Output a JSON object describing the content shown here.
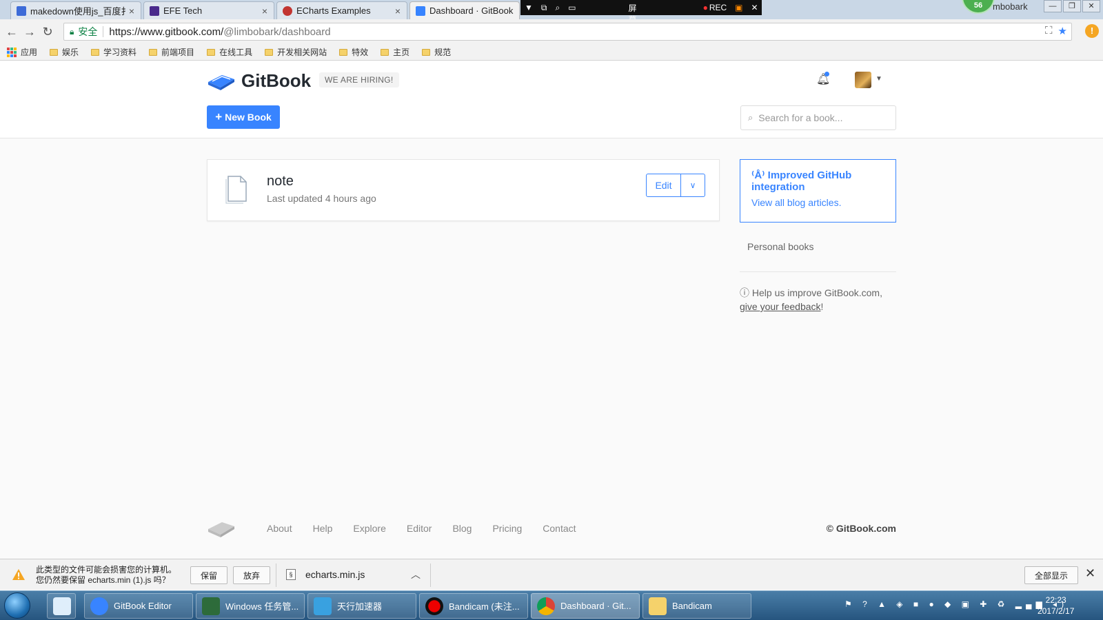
{
  "browser": {
    "tabs": [
      {
        "label": "makedown使用js_百度扌",
        "favicon_color": "#3d6bd8"
      },
      {
        "label": "EFE Tech",
        "favicon_color": "#4a2a8c"
      },
      {
        "label": "ECharts Examples",
        "favicon_color": "#c23531"
      },
      {
        "label": "Dashboard · GitBook",
        "favicon_color": "#3884ff"
      }
    ],
    "rec_bar": {
      "fullscreen": "全屏幕",
      "rec": "REC"
    },
    "profile_badge": "56",
    "profile_name": "mbobark",
    "secure_label": "安全",
    "url_host": "https://www.gitbook.com/",
    "url_path": "@limbobark/dashboard",
    "bookmarks": [
      "应用",
      "娱乐",
      "学习资料",
      "前端项目",
      "在线工具",
      "开发相关网站",
      "特效",
      "主页",
      "规范"
    ]
  },
  "header": {
    "logo_text": "GitBook",
    "hiring": "WE ARE HIRING!",
    "new_book": "New Book",
    "search_placeholder": "Search for a book..."
  },
  "book": {
    "title": "note",
    "meta": "Last updated 4 hours ago",
    "edit_label": "Edit"
  },
  "sidebar": {
    "blog_title": "Improved GitHub integration",
    "blog_link": "View all blog articles.",
    "personal_books": "Personal books",
    "help_text": "Help us improve GitBook.com,",
    "feedback_link": "give your feedback",
    "feedback_suffix": "!"
  },
  "footer": {
    "links": [
      "About",
      "Help",
      "Explore",
      "Editor",
      "Blog",
      "Pricing",
      "Contact"
    ],
    "copyright": "© GitBook.com"
  },
  "download_bar": {
    "warning_line1": "此类型的文件可能会损害您的计算机。",
    "warning_line2": "您仍然要保留 echarts.min (1).js 吗？",
    "keep": "保留",
    "discard": "放弃",
    "filename": "echarts.min.js",
    "show_all": "全部显示"
  },
  "taskbar": {
    "items": [
      "GitBook Editor",
      "Windows 任务管...",
      "天行加速器",
      "Bandicam (未注...",
      "Dashboard · Git...",
      "Bandicam"
    ],
    "time": "22:23",
    "date": "2017/2/17"
  },
  "colors": {
    "brand": "#3884ff",
    "text_dark": "#242a31"
  }
}
